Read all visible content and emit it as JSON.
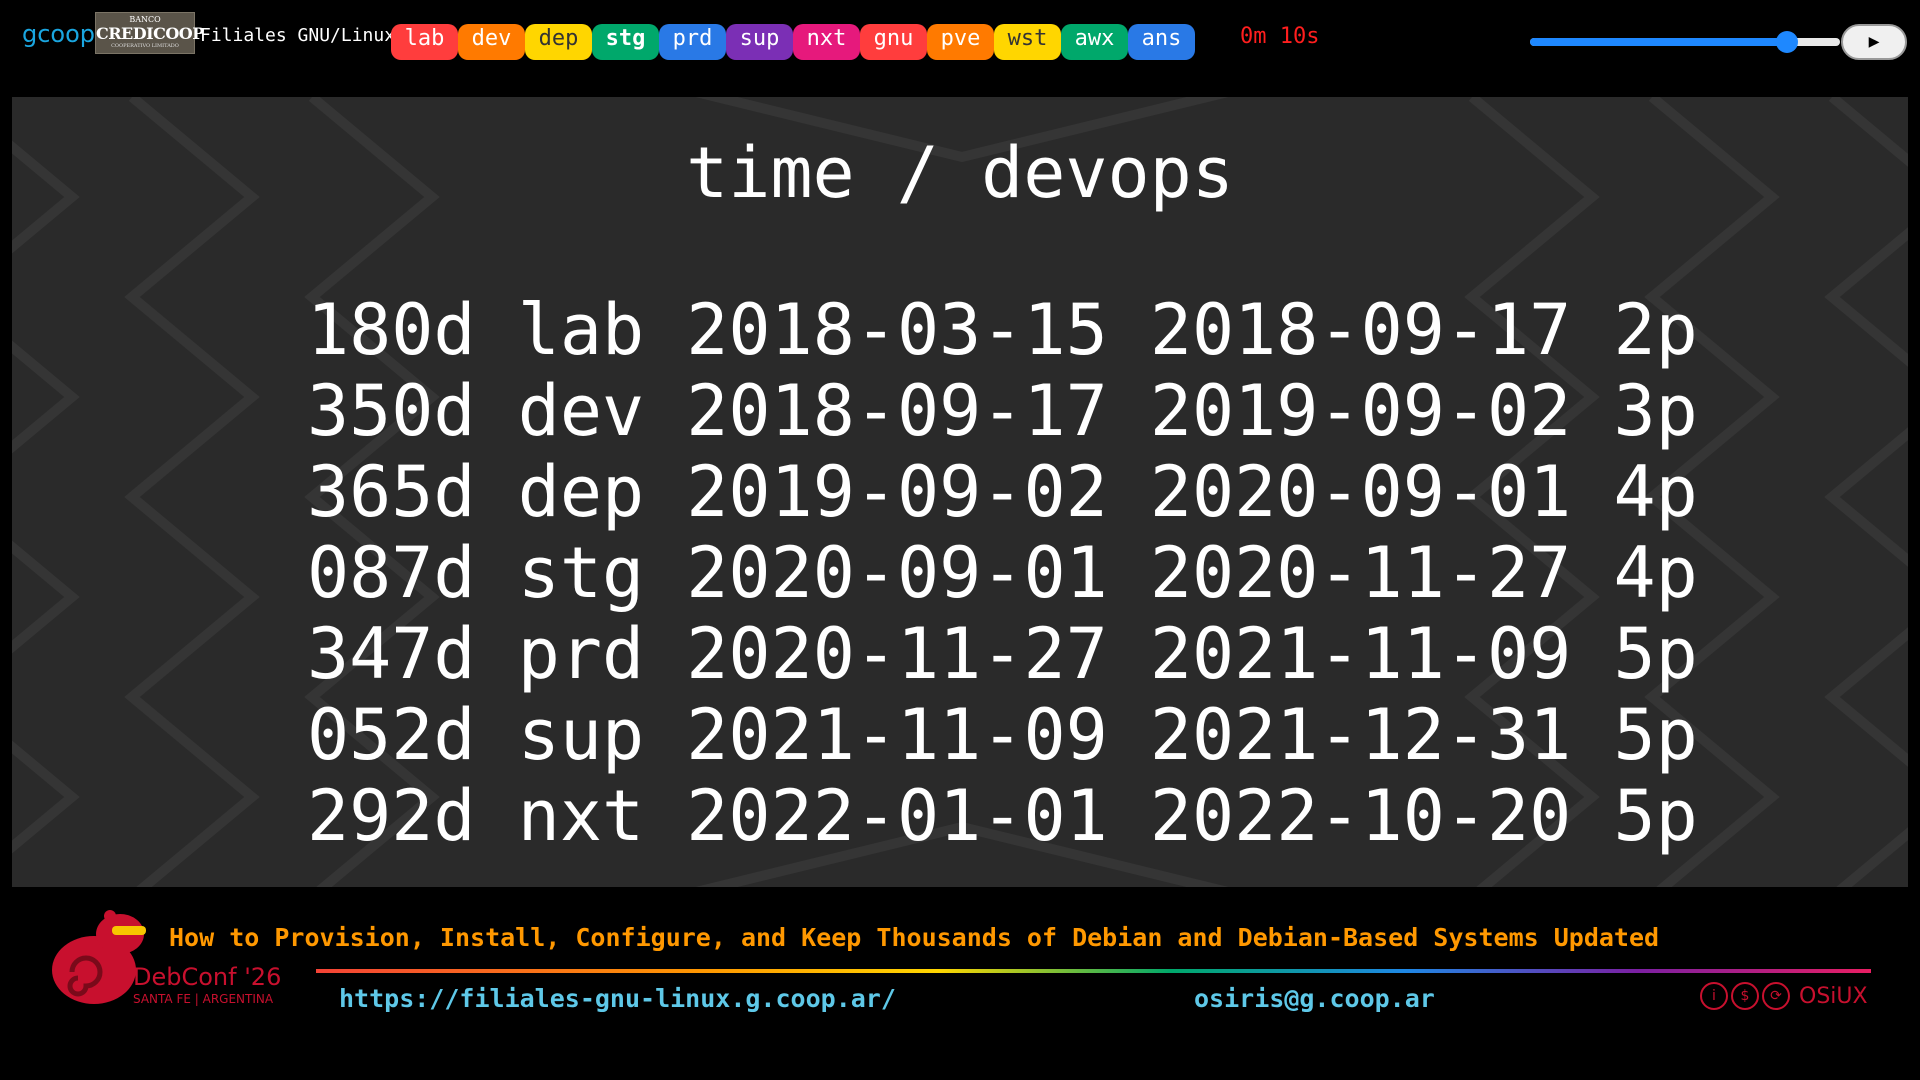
{
  "header": {
    "gcoop_logo": "gcoop",
    "bank_logo_top": "BANCO",
    "bank_logo_name": "CREDICOOP",
    "bank_logo_bottom": "COOPERATIVO LIMITADO",
    "title": "Filiales GNU/Linux",
    "tags": [
      {
        "label": "lab",
        "color": "#ff3d3d",
        "active": false
      },
      {
        "label": "dev",
        "color": "#ff7a00",
        "active": false
      },
      {
        "label": "dep",
        "color": "#ffd600",
        "active": false
      },
      {
        "label": "stg",
        "color": "#00a86b",
        "active": true
      },
      {
        "label": "prd",
        "color": "#2979e6",
        "active": false
      },
      {
        "label": "sup",
        "color": "#7b2fb5",
        "active": false
      },
      {
        "label": "nxt",
        "color": "#e6197c",
        "active": false
      },
      {
        "label": "gnu",
        "color": "#ff3d3d",
        "active": false
      },
      {
        "label": "pve",
        "color": "#ff7a00",
        "active": false
      },
      {
        "label": "wst",
        "color": "#ffd600",
        "active": false
      },
      {
        "label": "awx",
        "color": "#00a86b",
        "active": false
      },
      {
        "label": "ans",
        "color": "#2979e6",
        "active": false
      }
    ],
    "timer": "0m 10s",
    "progress": 0.83,
    "play_icon": "▶"
  },
  "slide": {
    "title": "time / devops",
    "rows": [
      "180d lab 2018-03-15 2018-09-17 2p",
      "350d dev 2018-09-17 2019-09-02 3p",
      "365d dep 2019-09-02 2020-09-01 4p",
      "087d stg 2020-09-01 2020-11-27 4p",
      "347d prd 2020-11-27 2021-11-09 5p",
      "052d sup 2021-11-09 2021-12-31 5p",
      "292d nxt 2022-01-01 2022-10-20 5p"
    ]
  },
  "footer": {
    "talk_title": "How to Provision, Install, Configure, and Keep Thousands of Debian and Debian-Based Systems Updated",
    "debconf": "DebConf '26",
    "debconf_sub": "SANTA FE | ARGENTINA",
    "url": "https://filiales-gnu-linux.g.coop.ar/",
    "email": "osiris@g.coop.ar",
    "author": "OSiUX",
    "license_icons": [
      "cc-by-icon",
      "cc-nc-icon",
      "cc-sa-icon"
    ]
  }
}
